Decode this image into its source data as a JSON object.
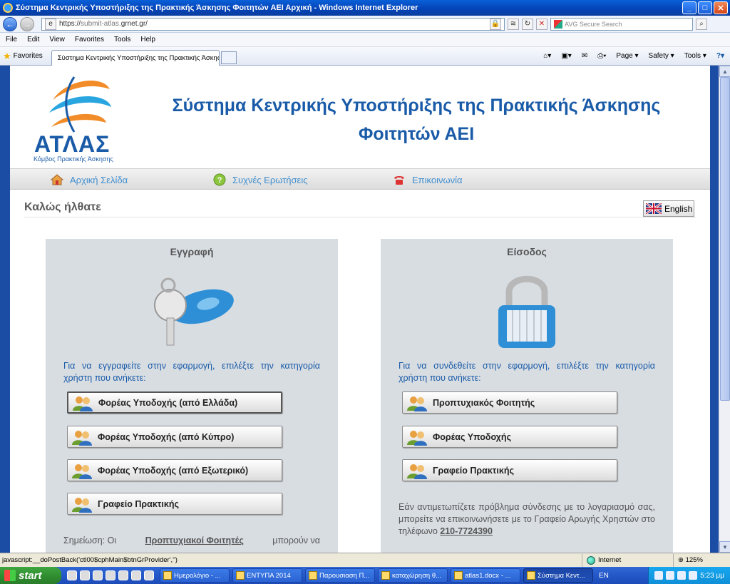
{
  "window": {
    "title": "Σύστημα Κεντρικής Υποστήριξης της Πρακτικής Άσκησης Φοιτητών ΑΕΙ Αρχική - Windows Internet Explorer",
    "minimize": "_",
    "maximize": "□",
    "close": "✕"
  },
  "browser": {
    "back": "←",
    "forward": "→",
    "address_prefix": "https://",
    "address_rest": "submit-atlas.",
    "address_domain": "grnet.gr/",
    "search_placeholder": "AVG Secure Search",
    "menu": [
      "File",
      "Edit",
      "View",
      "Favorites",
      "Tools",
      "Help"
    ],
    "favorites_label": "Favorites",
    "tab_title": "Σύστημα Κεντρικής Υποστήριξης της Πρακτικής Άσκησ...",
    "commands": [
      "Page ▾",
      "Safety ▾",
      "Tools ▾"
    ]
  },
  "site": {
    "logo_text": "ΑΤΛΑΣ",
    "logo_subtitle": "Κόμβος Πρακτικής Άσκησης",
    "title_line1": "Σύστημα Κεντρικής Υποστήριξης της Πρακτικής Άσκησης",
    "title_line2": "Φοιτητών ΑΕΙ",
    "nav": {
      "home": "Αρχική Σελίδα",
      "faq": "Συχνές Ερωτήσεις",
      "contact": "Επικοινωνία"
    },
    "welcome": "Καλώς ήλθατε",
    "language_button": "English"
  },
  "register": {
    "title": "Εγγραφή",
    "description": "Για να εγγραφείτε στην εφαρμογή, επιλέξτε την κατηγορία χρήστη που ανήκετε:",
    "buttons": [
      "Φορέας Υποδοχής (από Ελλάδα)",
      "Φορέας Υποδοχής (από Κύπρο)",
      "Φορέας Υποδοχής (από Εξωτερικό)",
      "Γραφείο Πρακτικής"
    ],
    "note_prefix": "Σημείωση: Οι",
    "note_link": "Προπτυχιακοί Φοιτητές",
    "note_suffix": "μπορούν να"
  },
  "login": {
    "title": "Είσοδος",
    "description": "Για να συνδεθείτε στην εφαρμογή, επιλέξτε την κατηγορία χρήστη που ανήκετε:",
    "buttons": [
      "Προπτυχιακός Φοιτητής",
      "Φορέας Υποδοχής",
      "Γραφείο Πρακτικής"
    ],
    "help_text": "Εάν αντιμετωπίζετε πρόβλημα σύνδεσης με το λογαριασμό σας, μπορείτε να επικοινωνήσετε με το Γραφείο Αρωγής Χρηστών στο τηλέφωνο",
    "phone": "210-7724390"
  },
  "status": {
    "text": "javascript:__doPostBack('ctl00$cphMain$btnGrProvider','')",
    "zone": "Internet",
    "zoom": "125%"
  },
  "taskbar": {
    "start": "start",
    "tasks": [
      "Ημερολόγιο - ...",
      "ΕΝΤΥΠΑ 2014",
      "Παρουσιαση Π...",
      "καταχώρηση θ...",
      "atlas1.docx - ...",
      "Σύστημα Κεντ..."
    ],
    "language": "EN",
    "clock": "5:23 μμ"
  },
  "colors": {
    "brand_blue": "#1a5ba8",
    "nav_link": "#3f8ecf",
    "panel_bg": "#d8dde2",
    "logo_orange": "#f28c28",
    "logo_lightblue": "#29a6e0"
  }
}
